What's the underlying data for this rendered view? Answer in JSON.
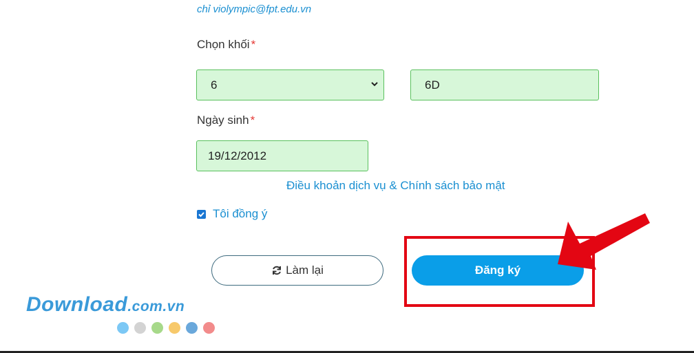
{
  "form": {
    "email_note": "chỉ violympic@fpt.edu.vn",
    "grade_label": "Chọn khối",
    "grade_value": "6",
    "class_value": "6D",
    "birthdate_label": "Ngày sinh",
    "birthdate_value": "19/12/2012",
    "required_mark": "*",
    "terms_link": "Điều khoản dịch vụ & Chính sách bảo mật",
    "agree_label": "Tôi đồng ý",
    "agree_checked": true,
    "reset_button": "Làm lại",
    "submit_button": "Đăng ký"
  },
  "watermark": {
    "brand": "Download",
    "domain": ".com.vn",
    "dot_colors": [
      "#7cc8f5",
      "#d3d3d3",
      "#a7d98a",
      "#f7c96b",
      "#6aa8db",
      "#f28b8b"
    ]
  },
  "colors": {
    "accent": "#0a9ee8",
    "field_bg": "#d7f7d9",
    "field_border": "#58c05c",
    "highlight": "#e30613"
  }
}
